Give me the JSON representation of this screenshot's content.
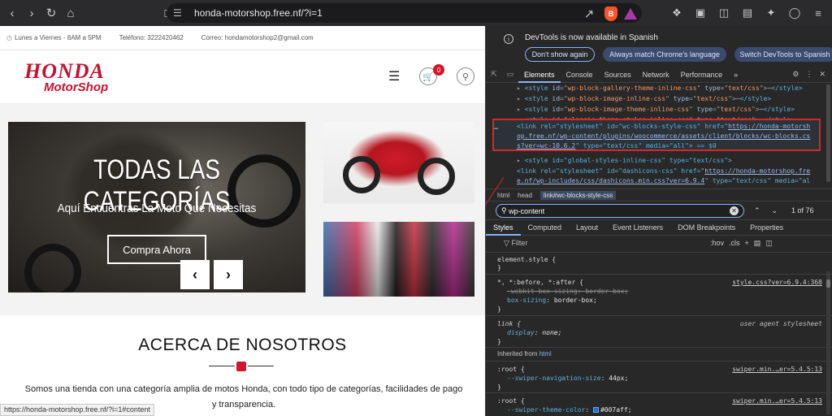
{
  "browser": {
    "url": "honda-motorshop.free.nf/?i=1",
    "brave_label": "B"
  },
  "site": {
    "topbar": {
      "hours": "Lunes a Viernes - 8AM a 5PM",
      "phone": "Teléfono: 3222420462",
      "email": "Correo: hondamotorshop2@gmail.com"
    },
    "logo": {
      "line1": "HONDA",
      "line2": "MotorShop"
    },
    "cart_count": "0",
    "hero": {
      "title": "TODAS LAS CATEGORÍAS",
      "subtitle": "Aquí Encuentras La Moto Que Necesitas",
      "button": "Compra Ahora",
      "prev": "‹",
      "next": "›"
    },
    "about": {
      "title": "ACERCA DE NOSOTROS",
      "text": "Somos una tienda con una categoría amplia de motos Honda, con todo tipo de categorías, facilidades de pago y transparencia."
    },
    "status_url": "https://honda-motorshop.free.nf/?i=1#content"
  },
  "devtools": {
    "notice": {
      "message": "DevTools is now available in Spanish",
      "dont_show": "Don't show again",
      "match_language": "Always match Chrome's language",
      "switch": "Switch DevTools to Spanish"
    },
    "tabs": [
      "Elements",
      "Console",
      "Sources",
      "Network",
      "Performance"
    ],
    "more_tabs": "»",
    "elements": {
      "lines": [
        {
          "id": "wp-block-gallery-theme-inline-css"
        },
        {
          "id": "wp-block-image-inline-css"
        },
        {
          "id": "wp-block-image-theme-inline-css"
        },
        {
          "id": "classic-theme-styles-inline-css"
        }
      ],
      "selected": {
        "line1_pre": "<link rel=\"stylesheet\" id=\"wc-blocks-style-css\" href=\"",
        "line1_link": "https://honda-motorsh",
        "line2_link": "op.free.nf/wp-content/plugins/woocommerce/assets/client/blocks/wc-blocks.cs",
        "line3_link": "s?ver=wc-10.6.2",
        "line3_post": "\" type=\"text/css\" media=\"all\"> == $0"
      },
      "after1": "<style id=\"global-styles-inline-css\" type=\"text/css\">",
      "after2_pre": "<link rel=\"stylesheet\" id=\"dashicons-css\" href=\"",
      "after2_link": "https://honda-motorshop.fre",
      "after3_link": "e.nf/wp-includes/css/dashicons.min.css?ver=6.9.4",
      "after3_post": "\" type=\"text/css\" media=\"al"
    },
    "breadcrumbs": [
      "html",
      "head",
      "link#wc-blocks-style-css"
    ],
    "find": {
      "query": "wp-content",
      "count": "1 of 76"
    },
    "sub_tabs": [
      "Styles",
      "Computed",
      "Layout",
      "Event Listeners",
      "DOM Breakpoints",
      "Properties"
    ],
    "filter": {
      "placeholder": "Filter",
      "hov": ":hov",
      "cls": ".cls"
    },
    "styles": {
      "element_style": "element.style {",
      "rule1_selector": "*, *:before, *:after {",
      "rule1_prop1": "-webkit-box-sizing",
      "rule1_val1": "border-box;",
      "rule1_prop2": "box-sizing",
      "rule1_val2": "border-box;",
      "rule1_src": "style.css?ver=6.9.4:368",
      "rule2_selector": "link {",
      "rule2_prop": "display",
      "rule2_val": "none;",
      "rule2_src": "user agent stylesheet",
      "inherited_label": "Inherited from",
      "inherited_tag": "html",
      "root1_selector": ":root {",
      "root1_prop": "--swiper-navigation-size",
      "root1_val": "44px;",
      "root1_src": "swiper.min.…er=5.4.5:13",
      "root2_selector": ":root {",
      "root2_prop": "--swiper-theme-color",
      "root2_val": "#007aff;",
      "root2_src": "swiper.min.…er=5.4.5:13"
    }
  },
  "colors": {
    "honda_red": "#c8102e",
    "devtools_accent": "#8ab4f8",
    "highlight": "#d12a2a",
    "swatch": "#007aff"
  }
}
